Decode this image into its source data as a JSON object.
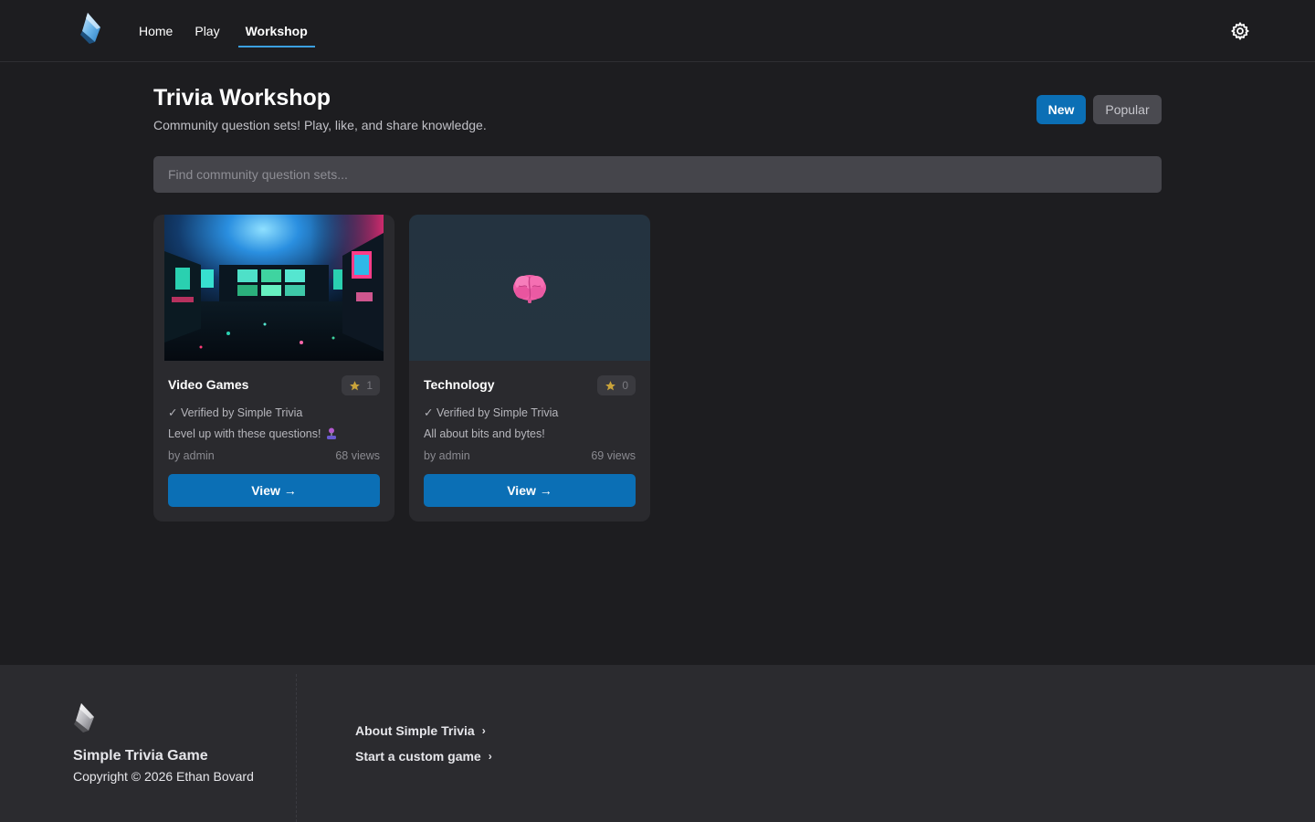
{
  "nav": {
    "items": [
      {
        "label": "Home",
        "active": false
      },
      {
        "label": "Play",
        "active": false
      },
      {
        "label": "Workshop",
        "active": true
      }
    ]
  },
  "header": {
    "title": "Trivia Workshop",
    "subtitle": "Community question sets! Play, like, and share knowledge."
  },
  "sort": {
    "new_label": "New",
    "popular_label": "Popular",
    "active": "New"
  },
  "search": {
    "placeholder": "Find community question sets...",
    "value": ""
  },
  "cards": [
    {
      "title": "Video Games",
      "likes": "1",
      "verified": "✓ Verified by Simple Trivia",
      "description": "Level up with these questions!",
      "description_emoji": "joystick-icon",
      "author": "by admin",
      "views": "68 views",
      "button_label": "View →",
      "thumbnail": "arcade-room-image"
    },
    {
      "title": "Technology",
      "likes": "0",
      "verified": "✓ Verified by Simple Trivia",
      "description": "All about bits and bytes!",
      "author": "by admin",
      "views": "69 views",
      "button_label": "View →",
      "thumbnail": "brain-icon"
    }
  ],
  "footer": {
    "name": "Simple Trivia Game",
    "copyright": "Copyright © 2026 Ethan Bovard",
    "links": [
      {
        "label": "About Simple Trivia"
      },
      {
        "label": "Start a custom game"
      }
    ]
  },
  "colors": {
    "background": "#1d1d20",
    "card": "#2a2a2e",
    "accent": "#0b6fb5",
    "footer": "#2b2b2f"
  }
}
